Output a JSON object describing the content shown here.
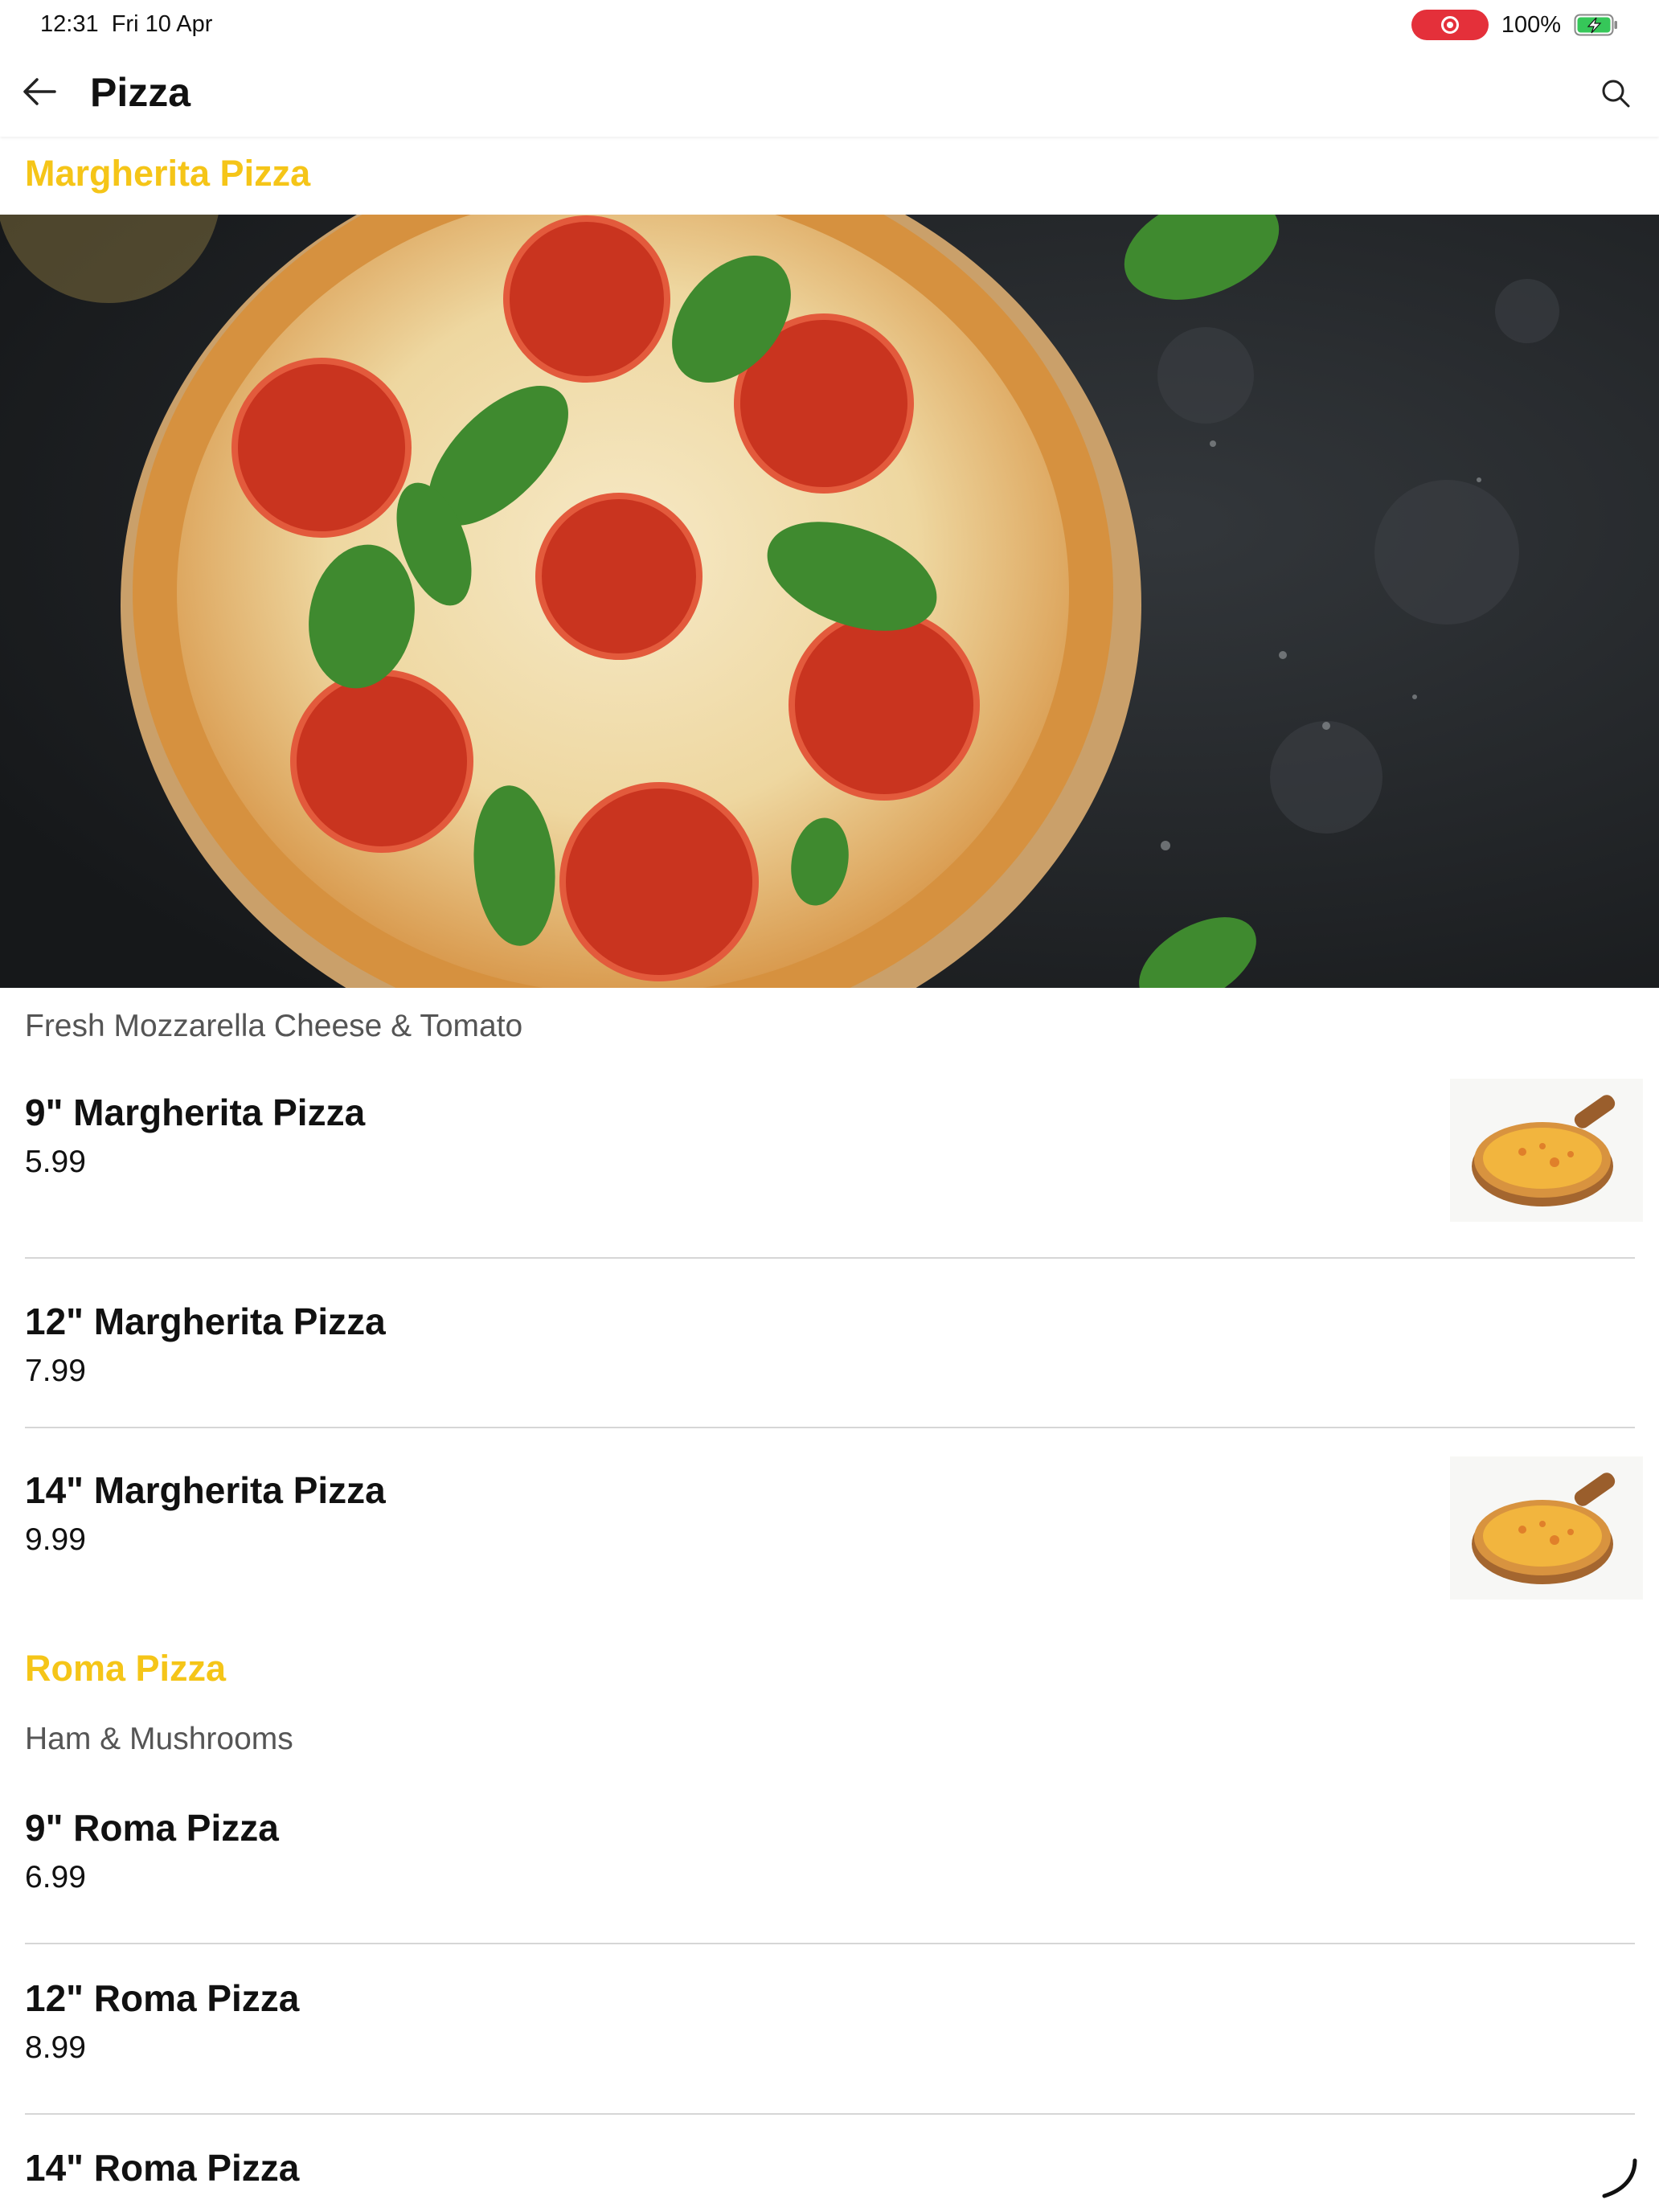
{
  "status_bar": {
    "time": "12:31",
    "date": "Fri 10 Apr",
    "battery": "100%",
    "recording_color": "#e4303a",
    "battery_color": "#36c759"
  },
  "app_bar": {
    "title": "Pizza",
    "back_icon": "arrow-left-icon",
    "search_icon": "search-icon"
  },
  "accent_color": "#f5c518",
  "sections": [
    {
      "title": "Margherita Pizza",
      "description": "Fresh Mozzarella Cheese & Tomato",
      "items": [
        {
          "name": "9\" Margherita Pizza",
          "price": "5.99"
        },
        {
          "name": "12\" Margherita Pizza",
          "price": "7.99"
        },
        {
          "name": "14\" Margherita Pizza",
          "price": "9.99"
        }
      ]
    },
    {
      "title": "Roma Pizza",
      "description": "Ham & Mushrooms",
      "items": [
        {
          "name": "9\" Roma Pizza",
          "price": "6.99"
        },
        {
          "name": "12\" Roma Pizza",
          "price": "8.99"
        },
        {
          "name": "14\" Roma Pizza",
          "price": ""
        }
      ]
    }
  ]
}
